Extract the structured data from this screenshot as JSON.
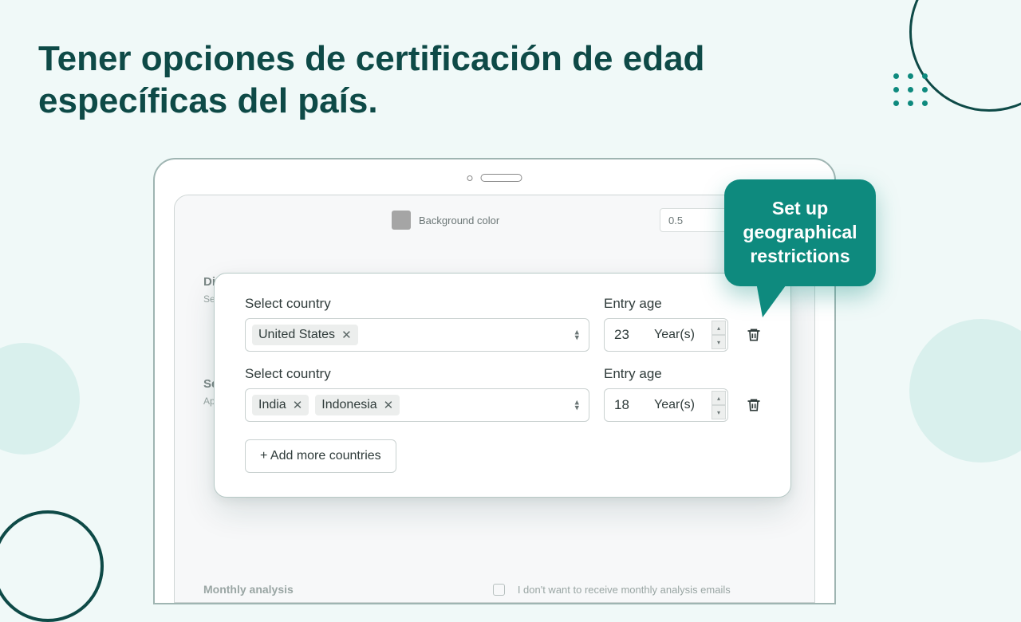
{
  "headline": "Tener opciones de certificación de edad específicas del país.",
  "background_setting": {
    "label": "Background color",
    "value": "0.5"
  },
  "sidebar": {
    "section1_title": "Disp",
    "section1_desc": "Se\nve",
    "section2_title": "Se",
    "section2_desc": "Ap\nac"
  },
  "modal": {
    "rows": [
      {
        "country_label": "Select country",
        "countries": [
          "United States"
        ],
        "age_label": "Entry age",
        "age_value": "23",
        "age_unit": "Year(s)"
      },
      {
        "country_label": "Select country",
        "countries": [
          "India",
          "Indonesia"
        ],
        "age_label": "Entry age",
        "age_value": "18",
        "age_unit": "Year(s)"
      }
    ],
    "add_button": "+ Add more countries"
  },
  "callout": "Set up geographical restrictions",
  "monthly": {
    "label": "Monthly analysis",
    "checkbox_text": "I don't want to receive monthly analysis emails"
  }
}
